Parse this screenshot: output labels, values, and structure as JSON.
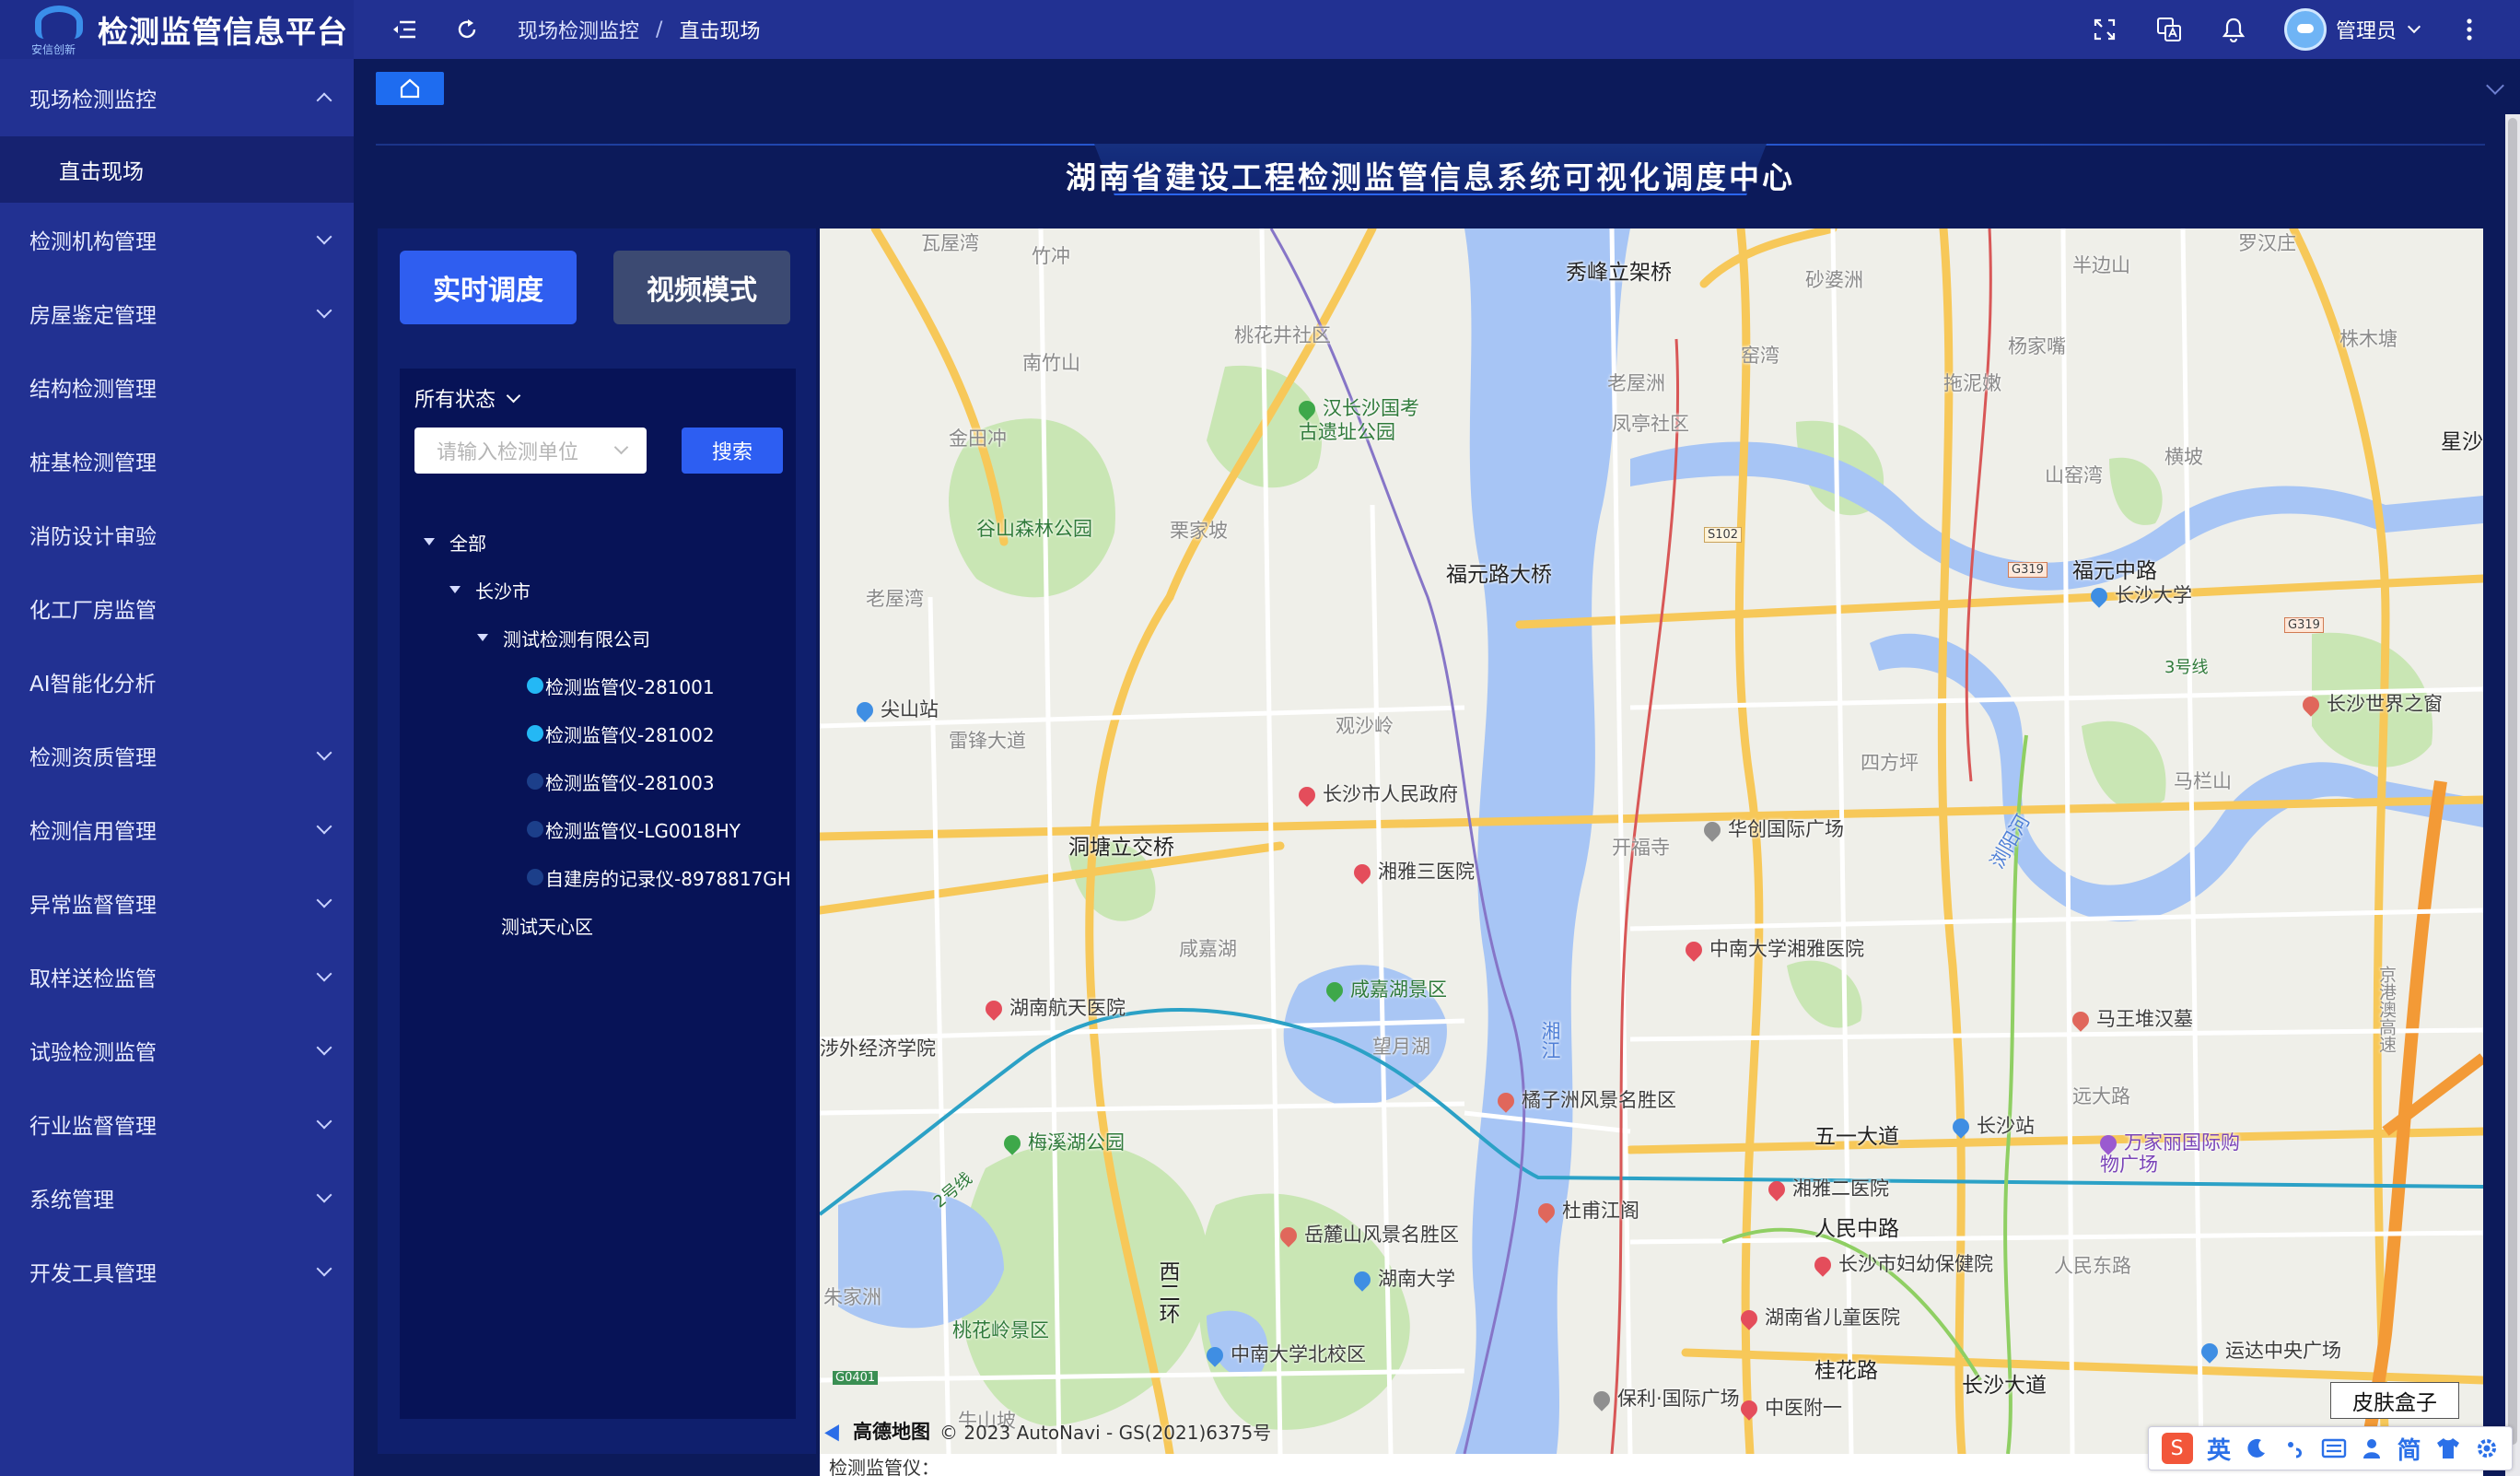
{
  "app": {
    "title": "检测监管信息平台",
    "logo_sub": "安信创新"
  },
  "sidebar": {
    "items": [
      {
        "label": "现场检测监控",
        "expanded": true,
        "children": [
          {
            "label": "直击现场",
            "active": true
          }
        ]
      },
      {
        "label": "检测机构管理",
        "has_children": true
      },
      {
        "label": "房屋鉴定管理",
        "has_children": true
      },
      {
        "label": "结构检测管理",
        "has_children": false
      },
      {
        "label": "桩基检测管理",
        "has_children": false
      },
      {
        "label": "消防设计审验",
        "has_children": false
      },
      {
        "label": "化工厂房监管",
        "has_children": false
      },
      {
        "label": "AI智能化分析",
        "has_children": false
      },
      {
        "label": "检测资质管理",
        "has_children": true
      },
      {
        "label": "检测信用管理",
        "has_children": true
      },
      {
        "label": "异常监督管理",
        "has_children": true
      },
      {
        "label": "取样送检监管",
        "has_children": true
      },
      {
        "label": "试验检测监管",
        "has_children": true
      },
      {
        "label": "行业监督管理",
        "has_children": true
      },
      {
        "label": "系统管理",
        "has_children": true
      },
      {
        "label": "开发工具管理",
        "has_children": true
      }
    ]
  },
  "topbar": {
    "breadcrumb": [
      "现场检测监控",
      "直击现场"
    ],
    "breadcrumb_sep": "/",
    "icons": [
      "menu-fold-icon",
      "refresh-icon",
      "fullscreen-icon",
      "translate-icon",
      "bell-icon",
      "more-icon"
    ],
    "user": {
      "name": "管理员"
    }
  },
  "banner": {
    "title": "湖南省建设工程检测监管信息系统可视化调度中心"
  },
  "panel": {
    "modes": [
      {
        "label": "实时调度",
        "active": true
      },
      {
        "label": "视频模式",
        "active": false
      }
    ],
    "status_filter": "所有状态",
    "unit_input": {
      "value": "",
      "placeholder": "请输入检测单位"
    },
    "search_label": "搜索",
    "tree": [
      {
        "label": "全部",
        "level": 0,
        "caret": true
      },
      {
        "label": "长沙市",
        "level": 1,
        "caret": true
      },
      {
        "label": "测试检测有限公司",
        "level": 2,
        "caret": true
      },
      {
        "label": "检测监管仪-281001",
        "level": 3,
        "status": "online"
      },
      {
        "label": "检测监管仪-281002",
        "level": 3,
        "status": "online"
      },
      {
        "label": "检测监管仪-281003",
        "level": 3,
        "status": "offline"
      },
      {
        "label": "检测监管仪-LG0018HY",
        "level": 3,
        "status": "offline"
      },
      {
        "label": "自建房的记录仪-8978817GH",
        "level": 3,
        "status": "offline"
      },
      {
        "label": "测试天心区",
        "level": 2,
        "caret": false
      }
    ],
    "status_colors": {
      "online": "#24b8f5",
      "offline": "#1c3f8a"
    }
  },
  "map": {
    "labels": [
      "瓦屋湾",
      "竹冲",
      "秀峰立架桥",
      "砂婆洲",
      "半边山",
      "罗汉庄",
      "株木塘",
      "桃花井社区",
      "南竹山",
      "汉长沙国考古遗址公园",
      "老屋洲",
      "窑湾",
      "拖泥嫩",
      "杨家嘴",
      "凤亭社区",
      "星沙",
      "金田冲",
      "谷山森林公园",
      "栗家坡",
      "山窑湾",
      "横坡",
      "S102",
      "福元路大桥",
      "G319",
      "福元中路",
      "长沙大学",
      "老屋湾",
      "G319",
      "3号线",
      "长沙世界之窗",
      "尖山站",
      "雷锋大道",
      "观沙岭",
      "长沙市人民政府",
      "四方坪",
      "马栏山",
      "洞塘立交桥",
      "开福寺",
      "华创国际广场",
      "浏阳河",
      "湘雅三医院",
      "咸嘉湖",
      "咸嘉湖景区",
      "中南大学湘雅医院",
      "湖南航天医院",
      "涉外经济学院",
      "望月湖",
      "湘江",
      "马王堆汉墓",
      "京港澳高速",
      "橘子洲风景名胜区",
      "远大路",
      "五一大道",
      "长沙站",
      "梅溪湖公园",
      "万家丽国际购物广场",
      "湘雅二医院",
      "杜甫江阁",
      "2号线",
      "人民中路",
      "岳麓山风景名胜区",
      "长沙市妇幼保健院",
      "人民东路",
      "湖南大学",
      "西二环",
      "朱家洲",
      "湖南省儿童医院",
      "桃花岭景区",
      "中南大学北校区",
      "运达中央广场",
      "桂花路",
      "长沙大道",
      "保利·国际广场",
      "中医附一",
      "牛山坡",
      "G0401"
    ],
    "provider": "高德地图",
    "copyright": "© 2023 AutoNavi - GS(2021)6375号",
    "skin_box": "皮肤盒子"
  },
  "below_map_text": "检测监管仪：",
  "ime": {
    "items": [
      "英",
      "简"
    ]
  },
  "colors": {
    "sidebar": "#223192",
    "main_bg": "#0c1a5a",
    "accent": "#2f5ef0",
    "panel": "#0f1f6d",
    "tree_bg": "#071357",
    "river": "#a7c5f5",
    "road_major": "#f7c859"
  }
}
